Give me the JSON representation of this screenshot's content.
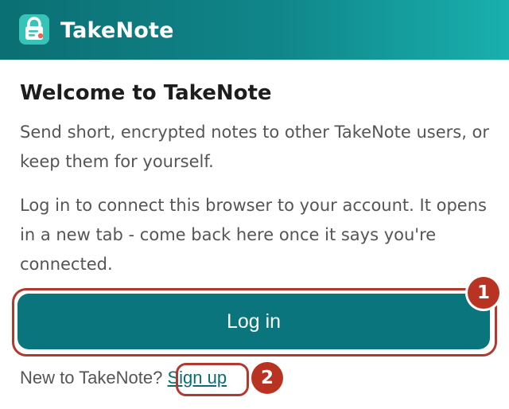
{
  "header": {
    "app_name": "TakeNote",
    "logo_icon": "lock-note-icon",
    "colors": {
      "gradient_start": "#0b6f73",
      "gradient_end": "#19b0ad"
    }
  },
  "main": {
    "heading": "Welcome to TakeNote",
    "intro": "Send short, encrypted notes to other TakeNote users, or keep them for yourself.",
    "login_info": "Log in to connect this browser to your account. It opens in a new tab - come back here once it says you're connected.",
    "login_button_label": "Log in",
    "signup_prompt": "New to TakeNote?",
    "signup_link_label": "Sign up"
  },
  "annotations": {
    "badge_1": "1",
    "badge_2": "2",
    "highlight_color": "#b03a2e"
  },
  "colors": {
    "accent": "#0a757c",
    "link": "#0a6d73",
    "body_text": "#555555"
  }
}
